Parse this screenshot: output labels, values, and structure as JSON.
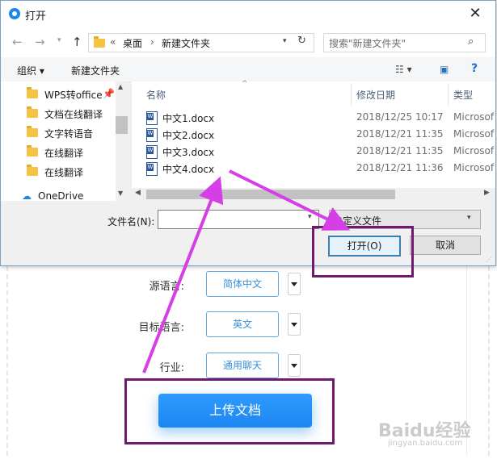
{
  "dialog": {
    "title": "打开",
    "breadcrumb": [
      "«",
      "桌面",
      "›",
      "新建文件夹"
    ],
    "search_placeholder": "搜索\"新建文件夹\"",
    "toolbar": {
      "organize": "组织 ▾",
      "new_folder": "新建文件夹"
    },
    "nav_items": [
      "WPS转office",
      "文档在线翻译",
      "文字转语音",
      "在线翻译",
      "在线翻译",
      "OneDrive"
    ],
    "columns": {
      "name": "名称",
      "date": "修改日期",
      "type": "类型"
    },
    "files": [
      {
        "name": "中文1.docx",
        "date": "2018/12/25 10:17",
        "type": "Microsof"
      },
      {
        "name": "中文2.docx",
        "date": "2018/12/21 11:35",
        "type": "Microsof"
      },
      {
        "name": "中文3.docx",
        "date": "2018/12/21 11:35",
        "type": "Microsof"
      },
      {
        "name": "中文4.docx",
        "date": "2018/12/21 11:36",
        "type": "Microsof"
      }
    ],
    "filename_label": "文件名(N):",
    "filename_value": "",
    "filetype_value": "自定义文件",
    "open_button": "打开(O)",
    "cancel_button": "取消"
  },
  "form": {
    "source_label": "源语言:",
    "source_value": "简体中文",
    "target_label": "目标语言:",
    "target_value": "英文",
    "industry_label": "行业:",
    "industry_value": "通用聊天",
    "upload_button": "上传文档"
  },
  "watermark": {
    "text": "Baidu经验",
    "sub": "jingyan.baidu.com"
  },
  "colors": {
    "accent": "#1e88e5",
    "annotation_arrow": "#d63ee6",
    "annotation_box": "#6f1a6f"
  }
}
